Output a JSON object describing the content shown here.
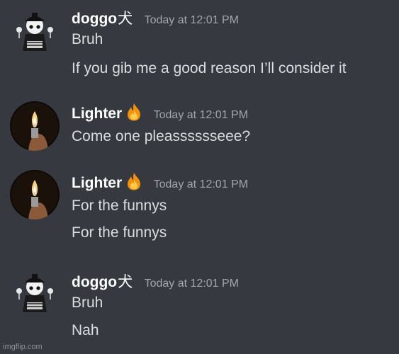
{
  "messages": [
    {
      "author": "doggo",
      "badge": "犬",
      "timestamp": "Today at 12:01 PM",
      "lines": [
        "Bruh",
        "If you gib me a good reason I’ll consider it"
      ]
    },
    {
      "author": "Lighter",
      "timestamp": "Today at 12:01 PM",
      "lines": [
        "Come one pleasssssseee?"
      ]
    },
    {
      "author": "Lighter",
      "timestamp": "Today at 12:01 PM",
      "lines": [
        "For the funnys",
        "For the funnys"
      ]
    },
    {
      "author": "doggo",
      "badge": "犬",
      "timestamp": "Today at 12:01 PM",
      "lines": [
        "Bruh",
        "Nah"
      ]
    }
  ],
  "watermark": "imgflip.com",
  "colors": {
    "background": "#36393f",
    "username": "#ffffff",
    "message_text": "#dcddde",
    "timestamp": "#a3a6aa"
  },
  "icons": [
    "fire-icon"
  ]
}
